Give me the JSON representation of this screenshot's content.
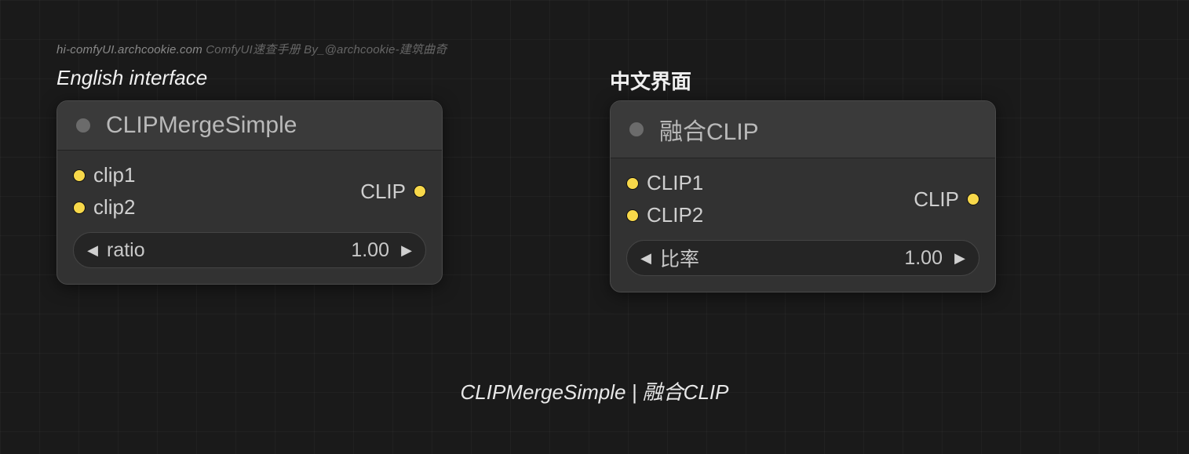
{
  "watermark": {
    "site": "hi-comfyUI.archcookie.com",
    "text": "ComfyUI速查手册 By_@archcookie-建筑曲奇"
  },
  "labels": {
    "en": "English interface",
    "zh": "中文界面"
  },
  "node_en": {
    "title": "CLIPMergeSimple",
    "inputs": [
      "clip1",
      "clip2"
    ],
    "outputs": [
      "CLIP"
    ],
    "widget": {
      "name": "ratio",
      "value": "1.00"
    }
  },
  "node_zh": {
    "title": "融合CLIP",
    "inputs": [
      "CLIP1",
      "CLIP2"
    ],
    "outputs": [
      "CLIP"
    ],
    "widget": {
      "name": "比率",
      "value": "1.00"
    }
  },
  "caption": "CLIPMergeSimple | 融合CLIP"
}
